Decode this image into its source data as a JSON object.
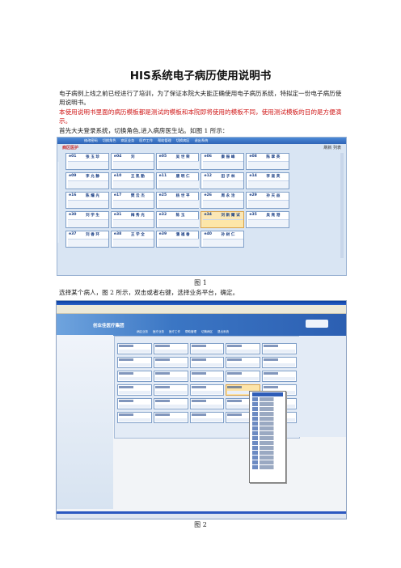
{
  "doc": {
    "title": "HIS系统电子病历使用说明书",
    "p1": "电子病例上线之前已经进行了培训，为了保证本院大夫能正确使用电子病历系统，特拟定一份电子病历使用说明书。",
    "p2": "本使用说明书里面的病历模板都是测试的模板和本院即将使用的模板不同，使用测试模板的目的是方便演示。",
    "p3": "首先大夫登录系统，切换角色,进入病房医生站。如图 1 所示：",
    "fig1_caption": "图 1",
    "p4": "选择某个病人，图 2 所示，双击或者右键，选择业务平台，确定。",
    "fig2_caption": "图 2"
  },
  "fig1": {
    "menu": [
      "修改密码",
      "切换角色",
      "病区业务",
      "医疗工作",
      "帮助管理",
      "切换病区",
      "退出系统"
    ],
    "header_left": "病区医护",
    "header_right": "刷新 列表",
    "beds": [
      {
        "no": "e01",
        "name": "张 玉 珍"
      },
      {
        "no": "e04",
        "name": "刘"
      },
      {
        "no": "e05",
        "name": "吴 世 荣"
      },
      {
        "no": "e06",
        "name": "秦 振 峰"
      },
      {
        "no": "e08",
        "name": "陈 翠 英"
      },
      {
        "no": "",
        "name": ""
      },
      {
        "no": "e09",
        "name": "李 允 静"
      },
      {
        "no": "e10",
        "name": "王 凯 勤"
      },
      {
        "no": "e11",
        "name": "唐 明 仁"
      },
      {
        "no": "e12",
        "name": "田 子 林"
      },
      {
        "no": "e14",
        "name": "李 淑 英"
      },
      {
        "no": "",
        "name": ""
      },
      {
        "no": "e16",
        "name": "陈 耀 光"
      },
      {
        "no": "e17",
        "name": "樊 云 杰"
      },
      {
        "no": "e25",
        "name": "杨 世 平"
      },
      {
        "no": "e26",
        "name": "周 永 洽"
      },
      {
        "no": "e29",
        "name": "孙 天 益"
      },
      {
        "no": "",
        "name": ""
      },
      {
        "no": "e30",
        "name": "刘 学 生"
      },
      {
        "no": "e31",
        "name": "梅 秀 光"
      },
      {
        "no": "e32",
        "name": "陈 玉"
      },
      {
        "no": "e34",
        "name": "刘 新 爾 试"
      },
      {
        "no": "e35",
        "name": "吴 亮 港"
      },
      {
        "no": "",
        "name": ""
      },
      {
        "no": "e37",
        "name": "刘 香 环"
      },
      {
        "no": "e38",
        "name": "王 学 全"
      },
      {
        "no": "e39",
        "name": "潘 福 香"
      },
      {
        "no": "e40",
        "name": "孙 树 仁"
      },
      {
        "no": "",
        "name": ""
      },
      {
        "no": "",
        "name": ""
      }
    ]
  },
  "fig2": {
    "banner_name": "创业佳医疗集团",
    "tabs": [
      "病区业务",
      "医疗业务",
      "医疗工作",
      "帮助管理",
      "切换病区",
      "退出系统"
    ]
  }
}
